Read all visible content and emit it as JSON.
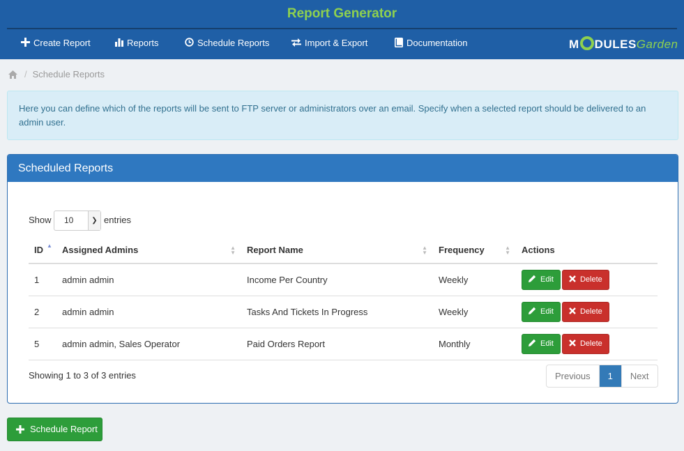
{
  "app": {
    "title": "Report Generator"
  },
  "nav": {
    "items": [
      {
        "label": "Create Report",
        "icon": "plus-icon"
      },
      {
        "label": "Reports",
        "icon": "bar-chart-icon"
      },
      {
        "label": "Schedule Reports",
        "icon": "clock-icon"
      },
      {
        "label": "Import & Export",
        "icon": "transfer-icon"
      },
      {
        "label": "Documentation",
        "icon": "book-icon"
      }
    ],
    "logo": {
      "part1": "M",
      "part2": "DULES",
      "part3": "Garden"
    }
  },
  "breadcrumb": {
    "home_icon": "home-icon",
    "current": "Schedule Reports"
  },
  "info": {
    "text": "Here you can define which of the reports will be sent to FTP server or administrators over an email. Specify when a selected report should be delivered to an admin user."
  },
  "panel": {
    "title": "Scheduled Reports",
    "length": {
      "show_label": "Show",
      "value": "10",
      "entries_label": "entries"
    },
    "columns": [
      "ID",
      "Assigned Admins",
      "Report Name",
      "Frequency",
      "Actions"
    ],
    "rows": [
      {
        "id": "1",
        "admins": "admin admin",
        "report": "Income Per Country",
        "frequency": "Weekly"
      },
      {
        "id": "2",
        "admins": "admin admin",
        "report": "Tasks And Tickets In Progress",
        "frequency": "Weekly"
      },
      {
        "id": "5",
        "admins": "admin admin, Sales Operator",
        "report": "Paid Orders Report",
        "frequency": "Monthly"
      }
    ],
    "actions": {
      "edit_label": "Edit",
      "delete_label": "Delete"
    },
    "info": "Showing 1 to 3 of 3 entries",
    "pager": {
      "previous": "Previous",
      "current": "1",
      "next": "Next"
    }
  },
  "schedule_button": {
    "label": "Schedule Report"
  },
  "colors": {
    "header": "#1f5fa6",
    "accent": "#8fd14f",
    "panel_head": "#2f78c0",
    "success": "#2d9d3a",
    "danger": "#c9302c"
  }
}
